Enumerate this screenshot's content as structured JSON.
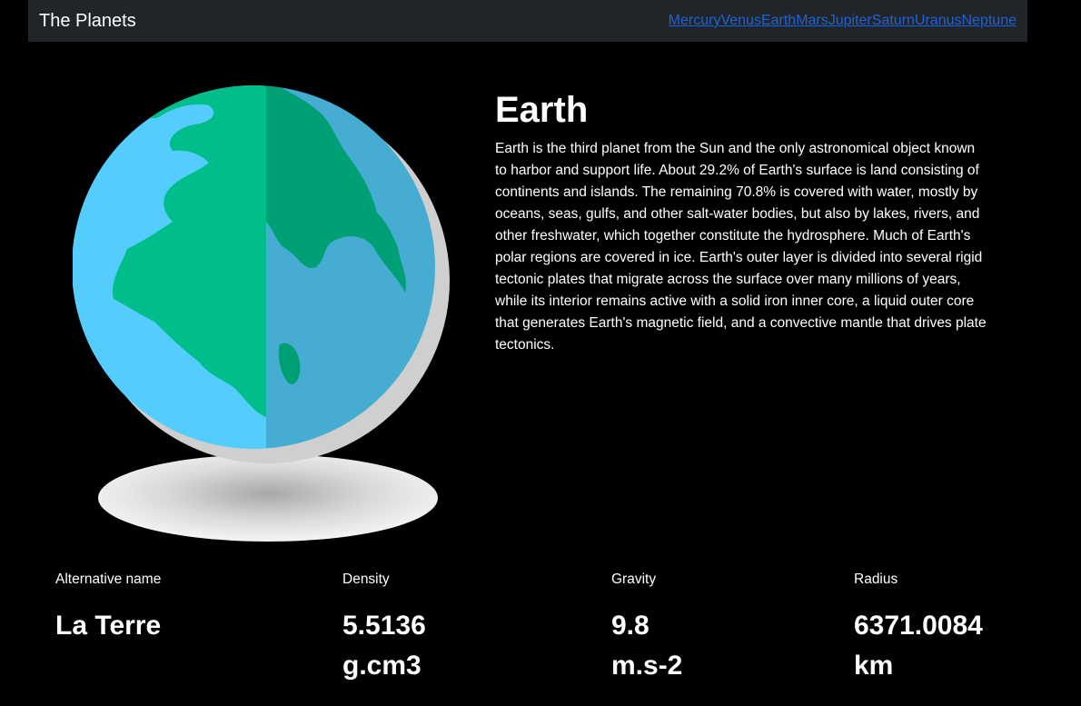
{
  "nav": {
    "brand": "The Planets",
    "links": [
      "Mercury",
      "Venus",
      "Earth",
      "Mars",
      "Jupiter",
      "Saturn",
      "Uranus",
      "Neptune"
    ],
    "link_color": "#1e62d9",
    "background": "#212529"
  },
  "planet": {
    "name": "Earth",
    "image_icon": "earth-globe-icon",
    "description": "Earth is the third planet from the Sun and the only astronomical object known to harbor and support life. About 29.2% of Earth's surface is land consisting of continents and islands. The remaining 70.8% is covered with water, mostly by oceans, seas, gulfs, and other salt-water bodies, but also by lakes, rivers, and other freshwater, which together constitute the hydrosphere. Much of Earth's polar regions are covered in ice. Earth's outer layer is divided into several rigid tectonic plates that migrate across the surface over many millions of years, while its interior remains active with a solid iron inner core, a liquid outer core that generates Earth's magnetic field, and a convective mantle that drives plate tectonics."
  },
  "stats": {
    "alt_name": {
      "label": "Alternative name",
      "value": "La Terre"
    },
    "density": {
      "label": "Density",
      "value": "5.5136",
      "unit": "g.cm3"
    },
    "gravity": {
      "label": "Gravity",
      "value": "9.8",
      "unit": "m.s-2"
    },
    "radius": {
      "label": "Radius",
      "value": "6371.0084",
      "unit": "km"
    }
  },
  "colors": {
    "ocean_light": "#55cdfc",
    "ocean_dark": "#47acd1",
    "land_light": "#00be8c",
    "land_dark": "#00a076"
  }
}
